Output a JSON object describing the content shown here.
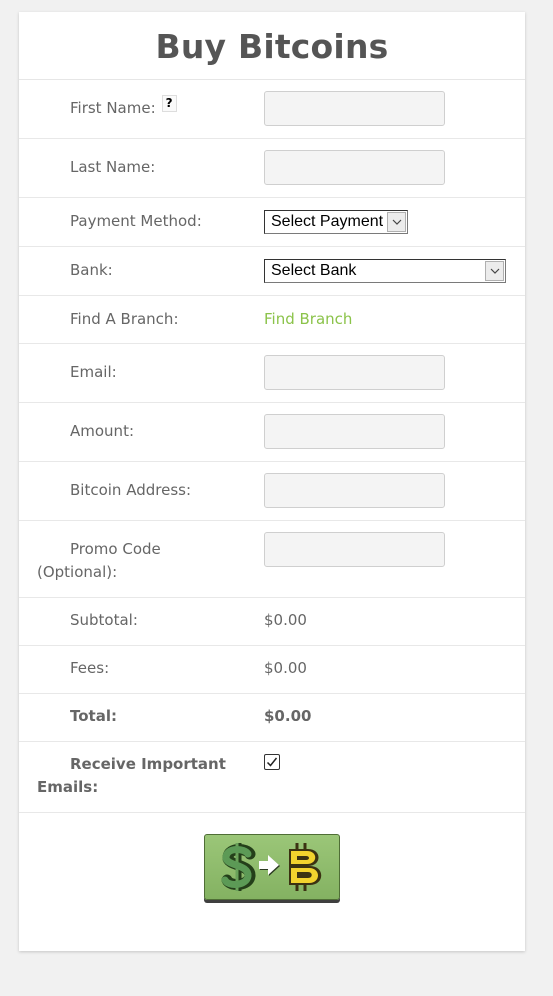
{
  "title": "Buy Bitcoins",
  "help_glyph": "?",
  "form": {
    "first_name_label": "First Name:",
    "last_name_label": "Last Name:",
    "payment_method_label": "Payment Method:",
    "payment_method_selected": "Select Payment",
    "bank_label": "Bank:",
    "bank_selected": "Select Bank",
    "find_branch_label": "Find A Branch:",
    "find_branch_link": "Find Branch",
    "email_label": "Email:",
    "amount_label": "Amount:",
    "bitcoin_address_label": "Bitcoin Address:",
    "promo_code_label": "Promo Code (Optional):",
    "subtotal_label": "Subtotal:",
    "subtotal_value": "$0.00",
    "fees_label": "Fees:",
    "fees_value": "$0.00",
    "total_label": "Total:",
    "total_value": "$0.00",
    "receive_emails_label": "Receive Important Emails:",
    "receive_emails_checked": true
  },
  "buy_button": {
    "icon": "dollar-to-bitcoin-icon"
  },
  "colors": {
    "accent_link": "#8bc34a",
    "button_green": "#8fbc6a",
    "bitcoin_yellow": "#f2d22e"
  }
}
